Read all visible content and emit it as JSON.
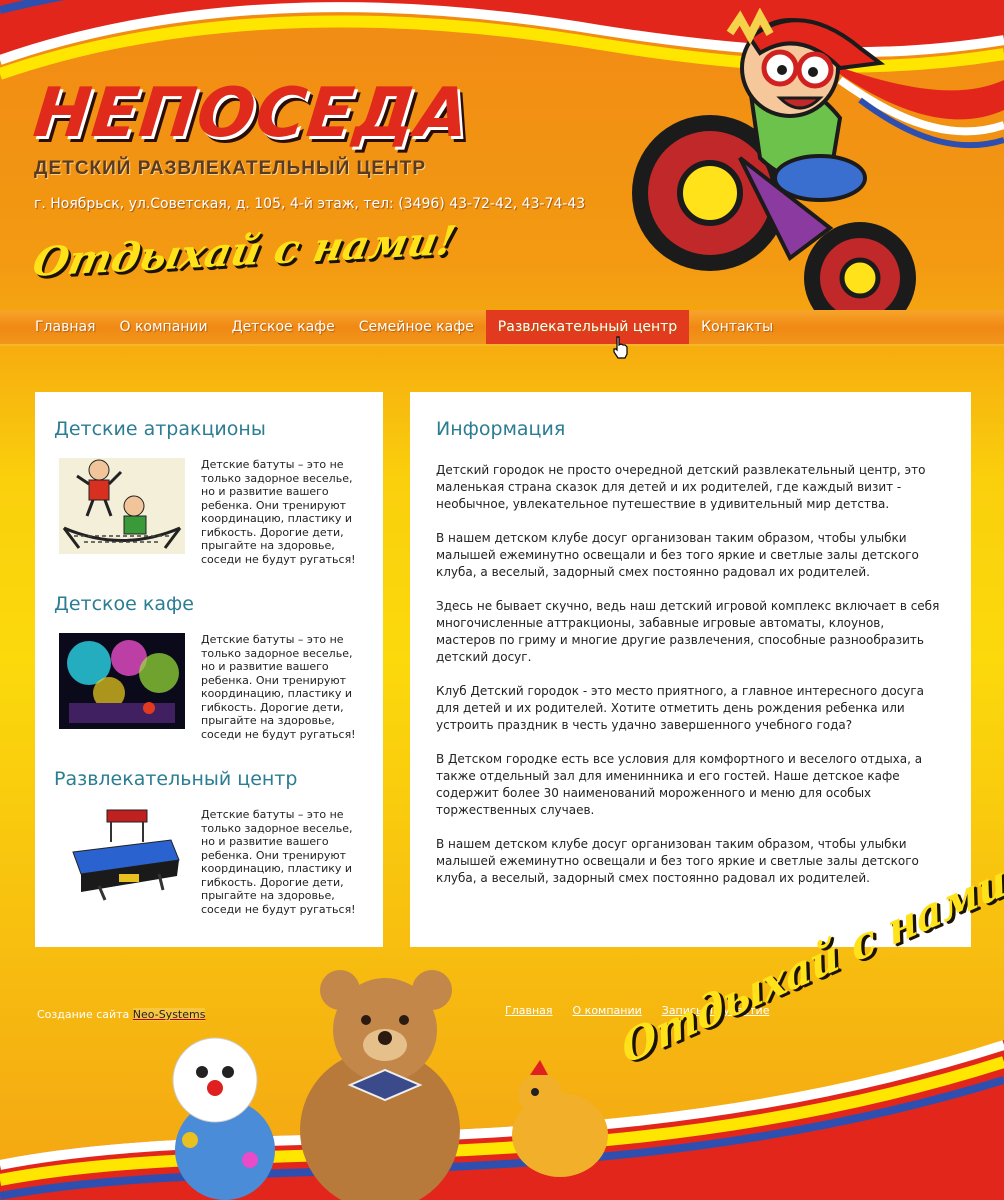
{
  "header": {
    "logo_title": "НЕПОСЕДА",
    "logo_subtitle": "ДЕТСКИЙ РАЗВЛЕКАТЕЛЬНЫЙ ЦЕНТР",
    "address": "г. Ноябрьск, ул.Советская, д. 105, 4-й этаж, тел: (3496) 43-72-42, 43-74-43",
    "slogan": "Отдыхай с нами!"
  },
  "nav": {
    "items": [
      {
        "label": "Главная"
      },
      {
        "label": "О компании"
      },
      {
        "label": "Детское кафе"
      },
      {
        "label": "Семейное кафе"
      },
      {
        "label": "Развлекательный центр",
        "active": true
      },
      {
        "label": "Контакты"
      }
    ]
  },
  "sidebar": {
    "blocks": [
      {
        "title": "Детские атракционы",
        "text": "Детские батуты – это не только задорное веселье, но и развитие вашего ребенка. Они тренируют координацию, пластику и гибкость. Дорогие дети, прыгайте на здоровье, соседи не будут ругаться!"
      },
      {
        "title": "Детское кафе",
        "text": "Детские батуты – это не только задорное веселье, но и развитие вашего ребенка. Они тренируют координацию, пластику и гибкость. Дорогие дети, прыгайте на здоровье, соседи не будут ругаться!"
      },
      {
        "title": "Развлекательный центр",
        "text": "Детские батуты – это не только задорное веселье, но и развитие вашего ребенка. Они тренируют координацию, пластику и гибкость. Дорогие дети, прыгайте на здоровье, соседи не будут ругаться!"
      }
    ]
  },
  "main": {
    "title": "Информация",
    "paragraphs": [
      "Детский городок не просто очередной детский развлекательный центр, это маленькая страна сказок для детей и их родителей, где каждый визит - необычное, увлекательное путешествие в удивительный мир детства.",
      "В нашем детском клубе досуг организован таким образом, чтобы улыбки малышей ежеминутно освещали и без того яркие и светлые залы детского клуба, а веселый, задорный смех постоянно радовал их родителей.",
      "Здесь не бывает скучно, ведь наш детский игровой комплекс включает в себя многочисленные аттракционы, забавные игровые автоматы, клоунов, мастеров по гриму и многие другие развлечения, способные разнообразить детский досуг.",
      "Клуб Детский городок - это место приятного, а главное интересного досуга для детей и их родителей. Хотите отметить день рождения ребенка или устроить праздник в честь удачно завершенного учебного года?",
      "В Детском городке есть все условия для комфортного и веселого отдыха, а также отдельный зал для именинника и его гостей. Наше детское кафе содержит более 30 наименований мороженного и меню для особых торжественных случаев.",
      "В нашем детском клубе досуг организован таким образом, чтобы улыбки малышей ежеминутно освещали и без того яркие и светлые залы детского клуба, а веселый, задорный смех постоянно радовал их родителей."
    ]
  },
  "footer": {
    "credit_prefix": "Создание сайта",
    "credit_link": "Neo-Systems",
    "links": [
      "Главная",
      "О компании",
      "Запись на участие"
    ],
    "slogan": "Отдыхай с нами!"
  },
  "colors": {
    "accent_red": "#e23a1e",
    "heading_teal": "#2a7d92",
    "slogan_yellow": "#ffe21a"
  },
  "icons": [
    "mouse-cursor-icon"
  ]
}
